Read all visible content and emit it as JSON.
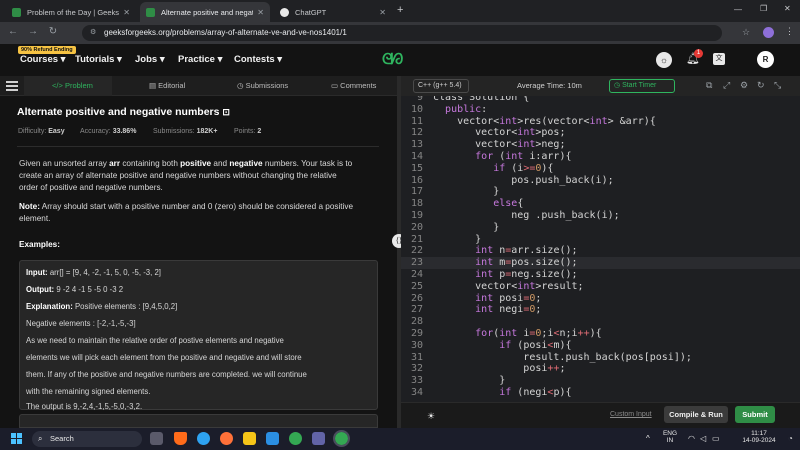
{
  "browser": {
    "tabs": [
      {
        "label": "Problem of the Day | GeeksforG",
        "active": false
      },
      {
        "label": "Alternate positive and negative",
        "active": true
      },
      {
        "label": "ChatGPT",
        "active": false
      }
    ],
    "new_tab": "+",
    "url": "geeksforgeeks.org/problems/array-of-alternate-ve-and-ve-nos1401/1"
  },
  "header": {
    "refund_badge": "90% Refund Ending",
    "menus": [
      "Courses",
      "Tutorials",
      "Jobs",
      "Practice",
      "Contests"
    ],
    "logo": "GfG",
    "notification_count": "1",
    "avatar": "R"
  },
  "left_tabs": [
    "Problem",
    "Editorial",
    "Submissions",
    "Comments"
  ],
  "problem": {
    "title": "Alternate positive and negative numbers",
    "difficulty_label": "Difficulty:",
    "difficulty": "Easy",
    "accuracy_label": "Accuracy:",
    "accuracy": "33.86%",
    "submissions_label": "Submissions:",
    "submissions": "182K+",
    "points_label": "Points:",
    "points": "2",
    "desc_1a": "Given an unsorted array ",
    "desc_1b": "arr",
    "desc_1c": " containing both ",
    "desc_1d": "positive",
    "desc_1e": " and ",
    "desc_1f": "negative",
    "desc_1g": " numbers. Your task is to",
    "desc_2": "create an array of alternate positive and negative numbers without changing the relative",
    "desc_3": "order of positive and negative numbers.",
    "note_label": "Note:",
    "note_1": " Array should start with a positive number and 0 (zero) should be considered a positive",
    "note_2": "element.",
    "examples_label": "Examples:",
    "example": {
      "input_label": "Input:",
      "input": " arr[] = [9, 4, -2, -1, 5, 0, -5, -3, 2]",
      "output_label": "Output:",
      "output": " 9 -2 4 -1 5 -5 0 -3 2",
      "expl_label": "Explanation:",
      "expl": " Positive elements : [9,4,5,0,2]",
      "neg": "Negative elements : [-2,-1,-5,-3]",
      "line1": "As we need to maintain the relative order of postive elements and negative",
      "line2": "elements we will pick each element from the positive and negative and will store",
      "line3": "them. If any of the positive and negative numbers are completed. we will continue",
      "line4": "with the remaining signed elements.",
      "line5": "The output is 9,-2,4,-1,5,-5,0,-3,2."
    }
  },
  "editor": {
    "language": "C++ (g++ 5.4)",
    "avg_time": "Average Time: 10m",
    "timer": "Start Timer",
    "custom_input": "Custom Input",
    "compile_run": "Compile & Run",
    "submit": "Submit",
    "code_lines": [
      {
        "n": "9",
        "html": "class Solution {"
      },
      {
        "n": "10",
        "html": "  <span class=\"kw\">public</span>:"
      },
      {
        "n": "11",
        "html": "    vector&lt;<span class=\"ty\">int</span>&gt;res(vector&lt;<span class=\"ty\">int</span>&gt; &amp;arr){"
      },
      {
        "n": "12",
        "html": "       vector&lt;<span class=\"ty\">int</span>&gt;pos;"
      },
      {
        "n": "13",
        "html": "       vector&lt;<span class=\"ty\">int</span>&gt;neg;"
      },
      {
        "n": "14",
        "html": "       <span class=\"kw\">for</span> (<span class=\"ty\">int</span> i:arr){"
      },
      {
        "n": "15",
        "html": "          <span class=\"kw\">if</span> (i<span class=\"op\">&gt;=</span><span class=\"num\">0</span>){"
      },
      {
        "n": "16",
        "html": "             pos.push_back(i);"
      },
      {
        "n": "17",
        "html": "          }"
      },
      {
        "n": "18",
        "html": "          <span class=\"kw\">else</span>{"
      },
      {
        "n": "19",
        "html": "             neg .push_back(i);"
      },
      {
        "n": "20",
        "html": "          }"
      },
      {
        "n": "21",
        "html": "       }"
      },
      {
        "n": "22",
        "html": "       <span class=\"ty\">int</span> n<span class=\"op\">=</span>arr.size();"
      },
      {
        "n": "23",
        "html": "       <span class=\"ty\">int</span> m<span class=\"op\">=</span>pos.size();"
      },
      {
        "n": "24",
        "html": "       <span class=\"ty\">int</span> p<span class=\"op\">=</span>neg.size();"
      },
      {
        "n": "25",
        "html": "       vector&lt;<span class=\"ty\">int</span>&gt;result;"
      },
      {
        "n": "26",
        "html": "       <span class=\"ty\">int</span> posi<span class=\"op\">=</span><span class=\"num\">0</span>;"
      },
      {
        "n": "27",
        "html": "       <span class=\"ty\">int</span> negi<span class=\"op\">=</span><span class=\"num\">0</span>;"
      },
      {
        "n": "28",
        "html": ""
      },
      {
        "n": "29",
        "html": "       <span class=\"kw\">for</span>(<span class=\"ty\">int</span> i<span class=\"op\">=</span><span class=\"num\">0</span>;i<span class=\"op\">&lt;</span>n;i<span class=\"op\">++</span>){"
      },
      {
        "n": "30",
        "html": "           <span class=\"kw\">if</span> (posi<span class=\"op\">&lt;</span>m){"
      },
      {
        "n": "31",
        "html": "               result.push_back(pos[posi]);"
      },
      {
        "n": "32",
        "html": "               posi<span class=\"op\">++</span>;"
      },
      {
        "n": "33",
        "html": "           }"
      },
      {
        "n": "34",
        "html": "           <span class=\"kw\">if</span> (negi<span class=\"op\">&lt;</span>p){"
      }
    ],
    "current_line": "23"
  },
  "taskbar": {
    "search": "Search",
    "lang1": "ENG",
    "lang2": "IN",
    "time": "11:17",
    "date": "14-09-2024"
  },
  "colors": {
    "accent": "#2f8d46",
    "brand_green": "#2fb55f"
  }
}
